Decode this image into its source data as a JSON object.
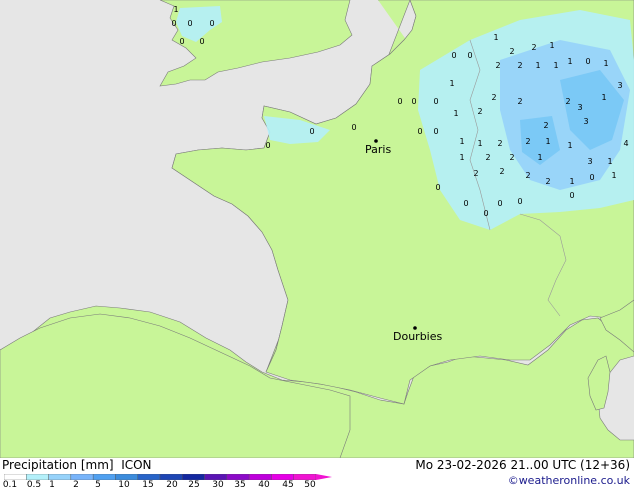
{
  "map": {
    "cities": [
      {
        "name": "Paris"
      },
      {
        "name": "Dourbies"
      }
    ],
    "precip_values": [
      {
        "v": "1"
      },
      {
        "v": "0"
      },
      {
        "v": "0"
      },
      {
        "v": "0"
      },
      {
        "v": "0"
      },
      {
        "v": "0"
      },
      {
        "v": "0"
      },
      {
        "v": "0"
      },
      {
        "v": "1"
      },
      {
        "v": "2"
      },
      {
        "v": "2"
      },
      {
        "v": "1"
      },
      {
        "v": "1"
      },
      {
        "v": "0"
      },
      {
        "v": "1"
      },
      {
        "v": "2"
      },
      {
        "v": "2"
      },
      {
        "v": "1"
      },
      {
        "v": "1"
      },
      {
        "v": "1"
      },
      {
        "v": "3"
      },
      {
        "v": "2"
      },
      {
        "v": "3"
      },
      {
        "v": "1"
      },
      {
        "v": "1"
      },
      {
        "v": "2"
      },
      {
        "v": "2"
      },
      {
        "v": "2"
      },
      {
        "v": "2"
      },
      {
        "v": "3"
      },
      {
        "v": "1"
      },
      {
        "v": "1"
      },
      {
        "v": "2"
      },
      {
        "v": "2"
      },
      {
        "v": "1"
      },
      {
        "v": "1"
      },
      {
        "v": "2"
      },
      {
        "v": "2"
      },
      {
        "v": "1"
      },
      {
        "v": "3"
      },
      {
        "v": "4"
      },
      {
        "v": "1"
      },
      {
        "v": "2"
      },
      {
        "v": "2"
      },
      {
        "v": "2"
      },
      {
        "v": "1"
      },
      {
        "v": "0"
      },
      {
        "v": "1"
      },
      {
        "v": "1"
      },
      {
        "v": "2"
      },
      {
        "v": "0"
      },
      {
        "v": "0"
      },
      {
        "v": "0"
      },
      {
        "v": "0"
      },
      {
        "v": "0"
      },
      {
        "v": "0"
      },
      {
        "v": "0"
      },
      {
        "v": "0"
      },
      {
        "v": "0"
      },
      {
        "v": "0"
      },
      {
        "v": "0"
      },
      {
        "v": "0"
      },
      {
        "v": "0"
      },
      {
        "v": "0"
      }
    ]
  },
  "footer": {
    "title": "Precipitation [mm]  ICON",
    "datetime": "Mo 23-02-2026 21..00 UTC (12+36)",
    "credit": "©weatheronline.co.uk",
    "legend": {
      "labels": [
        "0.1",
        "0.5",
        "1",
        "2",
        "5",
        "10",
        "15",
        "20",
        "25",
        "30",
        "35",
        "40",
        "45",
        "50"
      ],
      "colors": [
        "#ffffff",
        "#b4f0fa",
        "#96d2fa",
        "#78b4fa",
        "#50a0f0",
        "#3c8cdc",
        "#2864c8",
        "#1e46b4",
        "#1428a0",
        "#5a14b4",
        "#8c0ac8",
        "#be00dc",
        "#e600e6",
        "#f014d2"
      ]
    }
  },
  "colors": {
    "sea": "#e6e6e6",
    "land": "#c8f598",
    "precip_light": "#b4f0fa",
    "precip_mid": "#96d2fa",
    "precip_strong": "#78c8f5"
  }
}
